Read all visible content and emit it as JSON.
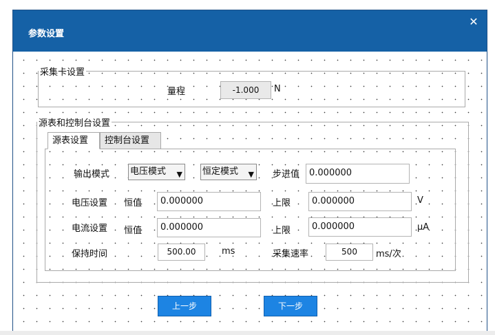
{
  "dialog": {
    "title": "参数设置",
    "close_icon": "close-icon"
  },
  "daq_group": {
    "legend": "采集卡设置",
    "range_label": "量程",
    "range_value": "-1.000",
    "range_unit": "N"
  },
  "source_group": {
    "legend": "源表和控制台设置",
    "tabs": [
      {
        "label": "源表设置",
        "active": true
      },
      {
        "label": "控制台设置",
        "active": false
      }
    ],
    "output_mode_label": "输出模式",
    "output_mode_value": "电压模式",
    "const_mode_value": "恒定模式",
    "step_label": "步进值",
    "step_value": "0.000000",
    "voltage": {
      "label": "电压设置",
      "const_label": "恒值",
      "const_value": "0.000000",
      "limit_label": "上限",
      "limit_value": "0.000000",
      "unit": "V"
    },
    "current": {
      "label": "电流设置",
      "const_label": "恒值",
      "const_value": "0.000000",
      "limit_label": "上限",
      "limit_value": "0.000000",
      "unit": "μA"
    },
    "hold_time": {
      "label": "保持时间",
      "value": "500.00",
      "unit": "ms"
    },
    "sample_rate": {
      "label": "采集速率",
      "value": "500",
      "unit": "ms/次"
    }
  },
  "buttons": {
    "prev": "上一步",
    "next": "下一步"
  },
  "colors": {
    "titlebar": "#1561a6",
    "button": "#1d84e3"
  }
}
